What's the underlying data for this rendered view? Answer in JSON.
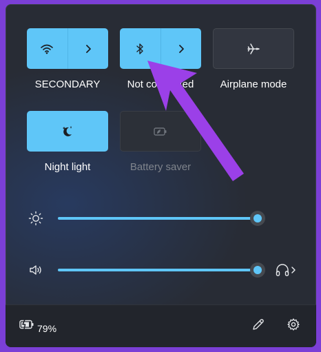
{
  "tiles": [
    {
      "label": "SECONDARY",
      "icon": "wifi-icon",
      "state": "on",
      "has_expand": true
    },
    {
      "label": "Not connected",
      "icon": "bluetooth-icon",
      "state": "on",
      "has_expand": true
    },
    {
      "label": "Airplane mode",
      "icon": "airplane-icon",
      "state": "off",
      "has_expand": false
    },
    {
      "label": "Night light",
      "icon": "night-light-icon",
      "state": "on",
      "has_expand": false
    },
    {
      "label": "Battery saver",
      "icon": "battery-saver-icon",
      "state": "disabled",
      "has_expand": false
    }
  ],
  "sliders": {
    "brightness": {
      "icon": "brightness-icon",
      "level": 1.0
    },
    "volume": {
      "icon": "speaker-icon",
      "level": 1.0,
      "output_icon": "headphones-icon"
    }
  },
  "footer": {
    "battery_percent": "79%",
    "battery_icon": "battery-charging-icon",
    "edit_icon": "pencil-icon",
    "settings_icon": "gear-icon"
  },
  "colors": {
    "accent": "#5fc6f8",
    "panel": "#282c35",
    "annotation_arrow": "#9b40e8"
  }
}
